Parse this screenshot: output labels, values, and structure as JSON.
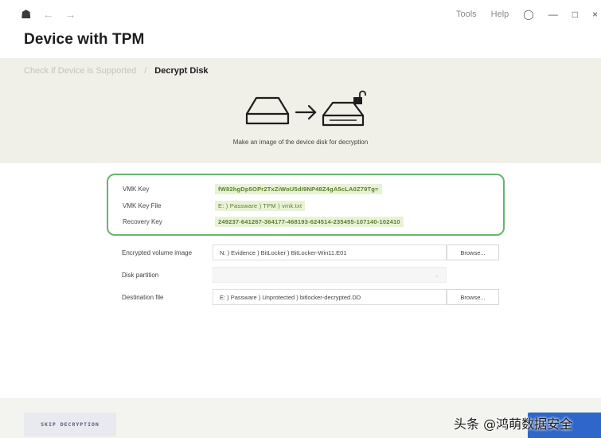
{
  "nav": {
    "home_icon": "home-icon",
    "back_icon": "arrow-left-icon",
    "forward_icon": "arrow-right-icon"
  },
  "menu": {
    "tools": "Tools",
    "help": "Help"
  },
  "page": {
    "title": "Device with TPM"
  },
  "breadcrumb": {
    "previous": "Check if Device is Supported",
    "separator": "/",
    "current": "Decrypt Disk"
  },
  "illustration": {
    "caption": "Make an image of the device disk for decryption"
  },
  "keys": [
    {
      "label": "VMK Key",
      "value": "fW82hgDp5OPr2TxZiWoU5dI9NP48Z4gA5cLA0Z79Tg="
    },
    {
      "label": "VMK Key File",
      "value": "E: ) Passware ) TPM ) vmk.txt"
    },
    {
      "label": "Recovery Key",
      "value": "249237-641267-364177-468193-624514-235455-107140-102410"
    }
  ],
  "fields": {
    "image": {
      "label": "Encrypted volume image",
      "value": "N: ) Evidence ) BitLocker ) BitLocker-Win11.E01",
      "button": "Browse..."
    },
    "partition": {
      "label": "Disk partition",
      "value": ""
    },
    "destination": {
      "label": "Destination file",
      "value": "E: ) Passware ) Unprotected ) bitlocker-decrypted.DD",
      "button": "Browse..."
    }
  },
  "footer": {
    "skip": "SKIP DECRYPTION"
  },
  "watermark": "头条 @鸿萌数据安全",
  "colors": {
    "accent_green": "#67b56c",
    "key_bg": "#e8f2d7",
    "key_text": "#5b7e2c",
    "primary_blue": "#2f66c9"
  }
}
